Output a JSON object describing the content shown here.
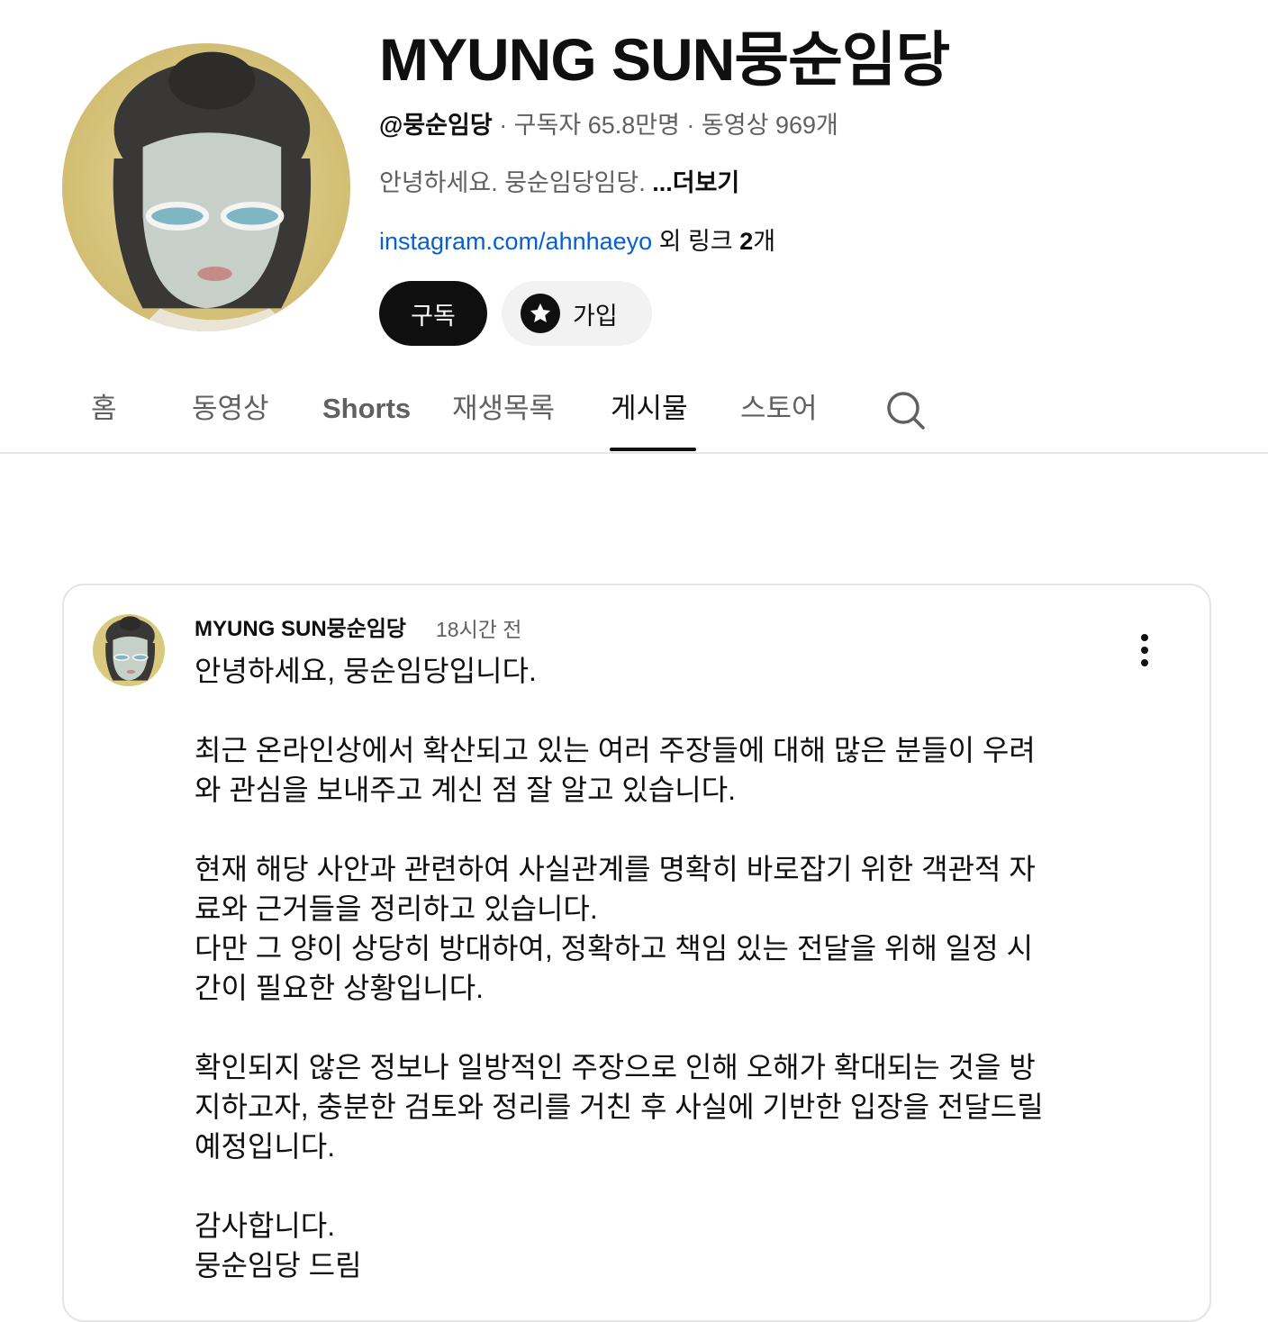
{
  "channel": {
    "title": "MYUNG SUN뭉순임당",
    "handle": "@뭉순임당",
    "meta": " · 구독자 65.8만명 · 동영상 969개",
    "description": "안녕하세요. 뭉순임당임당. ",
    "description_more": "...더보기",
    "link": "instagram.com/ahnhaeyo",
    "link_extra_prefix": " 외 링크 ",
    "link_extra_count": "2",
    "link_extra_suffix": "개",
    "subscribe_label": "구독",
    "join_label": "가입"
  },
  "tabs": [
    {
      "label": "홈"
    },
    {
      "label": "동영상"
    },
    {
      "label": "Shorts"
    },
    {
      "label": "재생목록"
    },
    {
      "label": "게시물"
    },
    {
      "label": "스토어"
    }
  ],
  "post": {
    "author": "MYUNG SUN뭉순임당",
    "time": "18시간 전",
    "lines": [
      "안녕하세요, 뭉순임당입니다.",
      "",
      "최근 온라인상에서 확산되고 있는 여러 주장들에 대해 많은 분들이 우려",
      "와 관심을 보내주고 계신 점 잘 알고 있습니다.",
      "",
      "현재 해당 사안과 관련하여 사실관계를 명확히 바로잡기 위한 객관적 자",
      "료와 근거들을 정리하고 있습니다.",
      "다만 그 양이 상당히 방대하여, 정확하고 책임 있는 전달을 위해 일정 시",
      "간이 필요한 상황입니다.",
      "",
      "확인되지 않은 정보나 일방적인 주장으로 인해 오해가 확대되는 것을 방",
      "지하고자, 충분한 검토와 정리를 거친 후 사실에 기반한 입장을 전달드릴",
      "예정입니다.",
      "",
      "감사합니다.",
      "뭉순임당 드림"
    ]
  }
}
